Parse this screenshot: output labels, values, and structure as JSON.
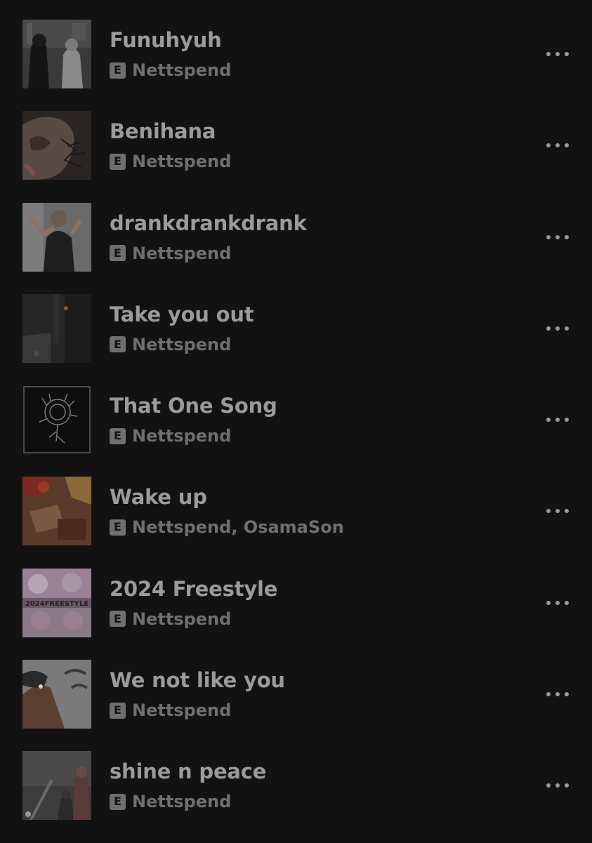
{
  "colors": {
    "background": "#121212",
    "title_text": "#9b9b9b",
    "secondary_text": "#6f6f6f",
    "explicit_badge": "#6f6f6f"
  },
  "explicit_badge_label": "E",
  "more_icon": "more-horizontal-icon",
  "tracks": [
    {
      "title": "Funuhyuh",
      "artist": "Nettspend",
      "explicit": true
    },
    {
      "title": "Benihana",
      "artist": "Nettspend",
      "explicit": true
    },
    {
      "title": "drankdrankdrank",
      "artist": "Nettspend",
      "explicit": true
    },
    {
      "title": "Take you out",
      "artist": "Nettspend",
      "explicit": true
    },
    {
      "title": "That One Song",
      "artist": "Nettspend",
      "explicit": true
    },
    {
      "title": "Wake up",
      "artist": "Nettspend, OsamaSon",
      "explicit": true
    },
    {
      "title": "2024 Freestyle",
      "artist": "Nettspend",
      "explicit": true,
      "cover_text": "2024FREESTYLE"
    },
    {
      "title": "We not like you",
      "artist": "Nettspend",
      "explicit": true
    },
    {
      "title": "shine n peace",
      "artist": "Nettspend",
      "explicit": true
    }
  ]
}
